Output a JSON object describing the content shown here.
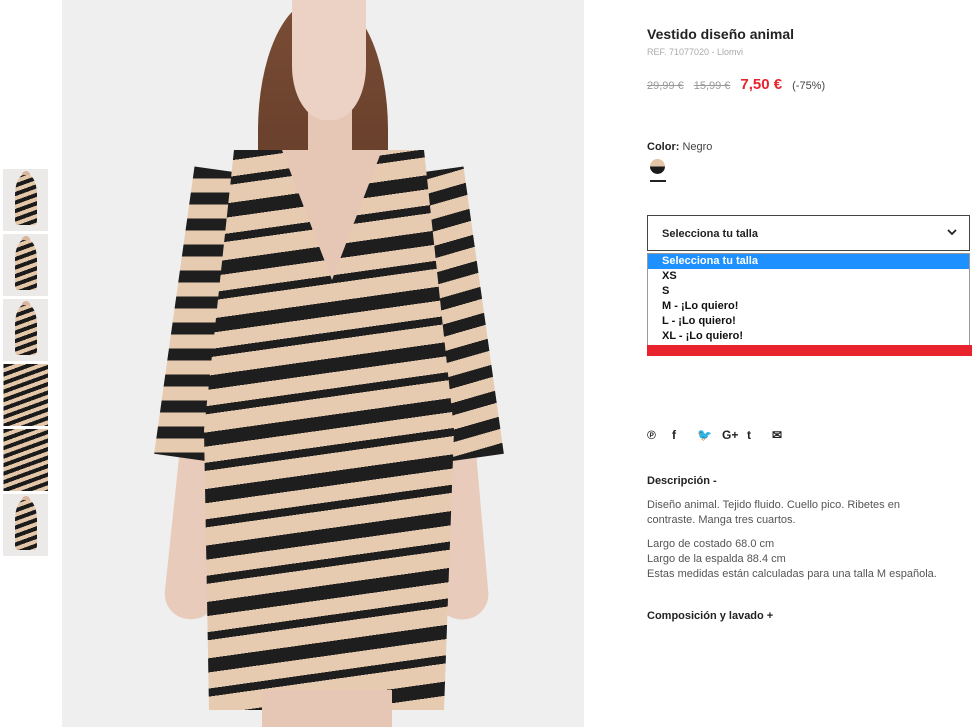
{
  "thumbnails": [
    {
      "kind": "model"
    },
    {
      "kind": "model"
    },
    {
      "kind": "model"
    },
    {
      "kind": "detail"
    },
    {
      "kind": "detail"
    },
    {
      "kind": "flat"
    }
  ],
  "product": {
    "title": "Vestido diseño animal",
    "ref": "REF. 71077020 - Llomvi",
    "prices": {
      "original": "29,99 €",
      "previous": "15,99 €",
      "sale": "7,50 €",
      "discount": "(-75%)"
    },
    "color_label": "Color:",
    "color_value": "Negro"
  },
  "size_select": {
    "value": "Selecciona tu talla",
    "options": [
      "Selecciona tu talla",
      "XS",
      "S",
      "M - ¡Lo quiero!",
      "L - ¡Lo quiero!",
      "XL - ¡Lo quiero!"
    ],
    "selected_index": 0
  },
  "social": [
    "pinterest-icon",
    "facebook-icon",
    "twitter-icon",
    "google-plus-icon",
    "tumblr-icon",
    "email-icon"
  ],
  "social_glyphs": [
    "℗",
    "f",
    "🐦",
    "G+",
    "t",
    "✉"
  ],
  "description": {
    "heading": "Descripción -",
    "para1_line1": "Diseño animal. Tejido fluido. Cuello pico. Ribetes en",
    "para1_line2": "contraste. Manga tres cuartos.",
    "para2_line1": "Largo de costado 68.0 cm",
    "para2_line2": "Largo de la espalda 88.4 cm",
    "para2_line3": "Estas medidas están calculadas para una talla M española."
  },
  "composition_heading": "Composición y lavado +",
  "colors": {
    "sale": "#e8232e",
    "select_highlight": "#1e90ff",
    "text": "#222222"
  }
}
